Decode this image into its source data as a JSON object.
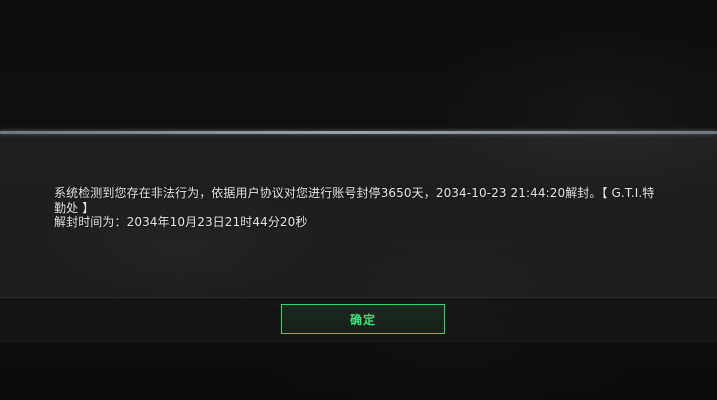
{
  "dialog": {
    "message_line1": "系统检测到您存在非法行为，依据用户协议对您进行账号封停3650天，2034-10-23 21:44:20解封。【 G.T.I.特",
    "message_line2": "勤处 】",
    "message_line3": "解封时间为：2034年10月23日21时44分20秒",
    "confirm_label": "确定"
  },
  "colors": {
    "accent": "#2fd46a",
    "text": "#e6e6e6",
    "divider": "#9aa3ad"
  }
}
